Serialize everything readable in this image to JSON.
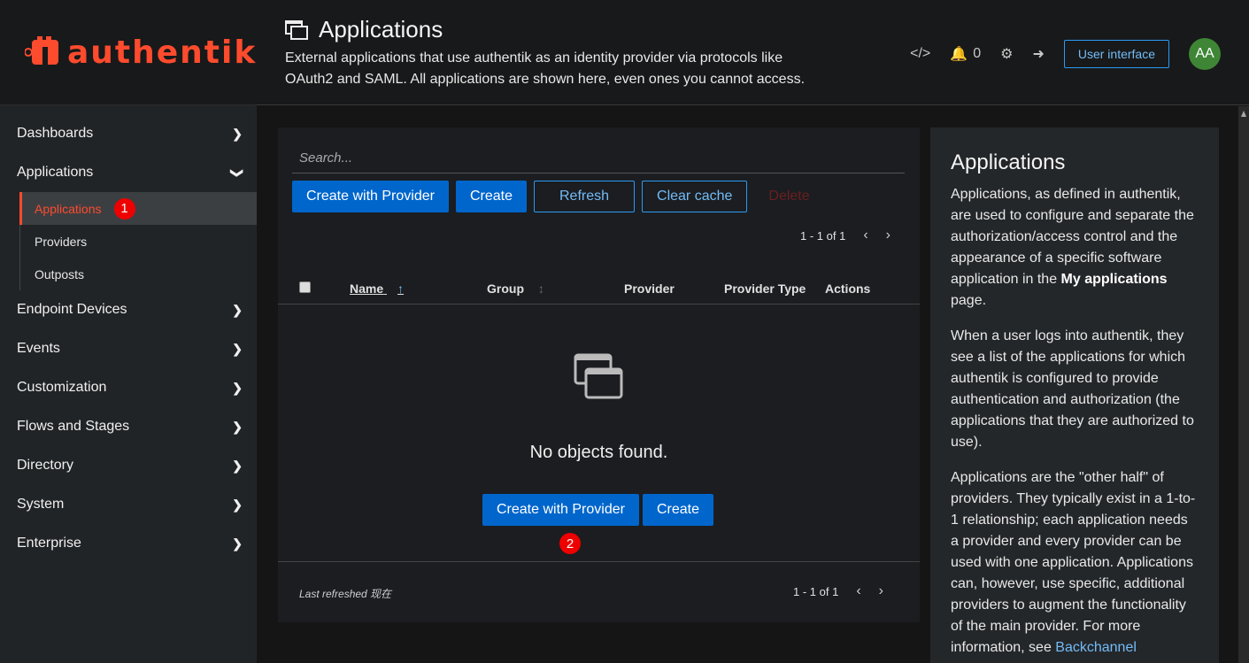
{
  "brand": {
    "name": "authentik",
    "color": "#fd4b2d"
  },
  "sidebar": {
    "items": [
      {
        "label": "Dashboards"
      },
      {
        "label": "Applications"
      },
      {
        "label": "Endpoint Devices"
      },
      {
        "label": "Events"
      },
      {
        "label": "Customization"
      },
      {
        "label": "Flows and Stages"
      },
      {
        "label": "Directory"
      },
      {
        "label": "System"
      },
      {
        "label": "Enterprise"
      }
    ],
    "subitems": [
      {
        "label": "Applications",
        "active": true,
        "badge": "1"
      },
      {
        "label": "Providers"
      },
      {
        "label": "Outposts"
      }
    ]
  },
  "header": {
    "title": "Applications",
    "description": "External applications that use authentik as an identity provider via protocols like OAuth2 and SAML. All applications are shown here, even ones you cannot access.",
    "notifications_count": "0",
    "user_interface_label": "User interface",
    "avatar_initials": "AA"
  },
  "table": {
    "search_placeholder": "Search...",
    "toolbar": {
      "create_with_provider": "Create with Provider",
      "create": "Create",
      "refresh": "Refresh",
      "clear_cache": "Clear cache",
      "delete": "Delete"
    },
    "pagination": "1 - 1 of 1",
    "columns": [
      "Name",
      "Group",
      "Provider",
      "Provider Type",
      "Actions"
    ],
    "empty_text": "No objects found.",
    "empty_actions": {
      "create_with_provider": "Create with Provider",
      "create": "Create"
    },
    "empty_badge": "2",
    "last_refreshed": "Last refreshed 现在"
  },
  "help": {
    "title": "Applications",
    "p1_start": "Applications, as defined in authentik, are used to configure and separate the authorization/access control and the appearance of a specific software application in the ",
    "p1_bold": "My applications",
    "p1_end": " page.",
    "p2": "When a user logs into authentik, they see a list of the applications for which authentik is configured to provide authentication and authorization (the applications that they are authorized to use).",
    "p3_start": "Applications are the \"other half\" of providers. They typically exist in a 1-to-1 relationship; each application needs a provider and every provider can be used with one application. Applications can, however, use specific, additional providers to augment the functionality of the main provider. For more information, see ",
    "p3_link": "Backchannel"
  }
}
